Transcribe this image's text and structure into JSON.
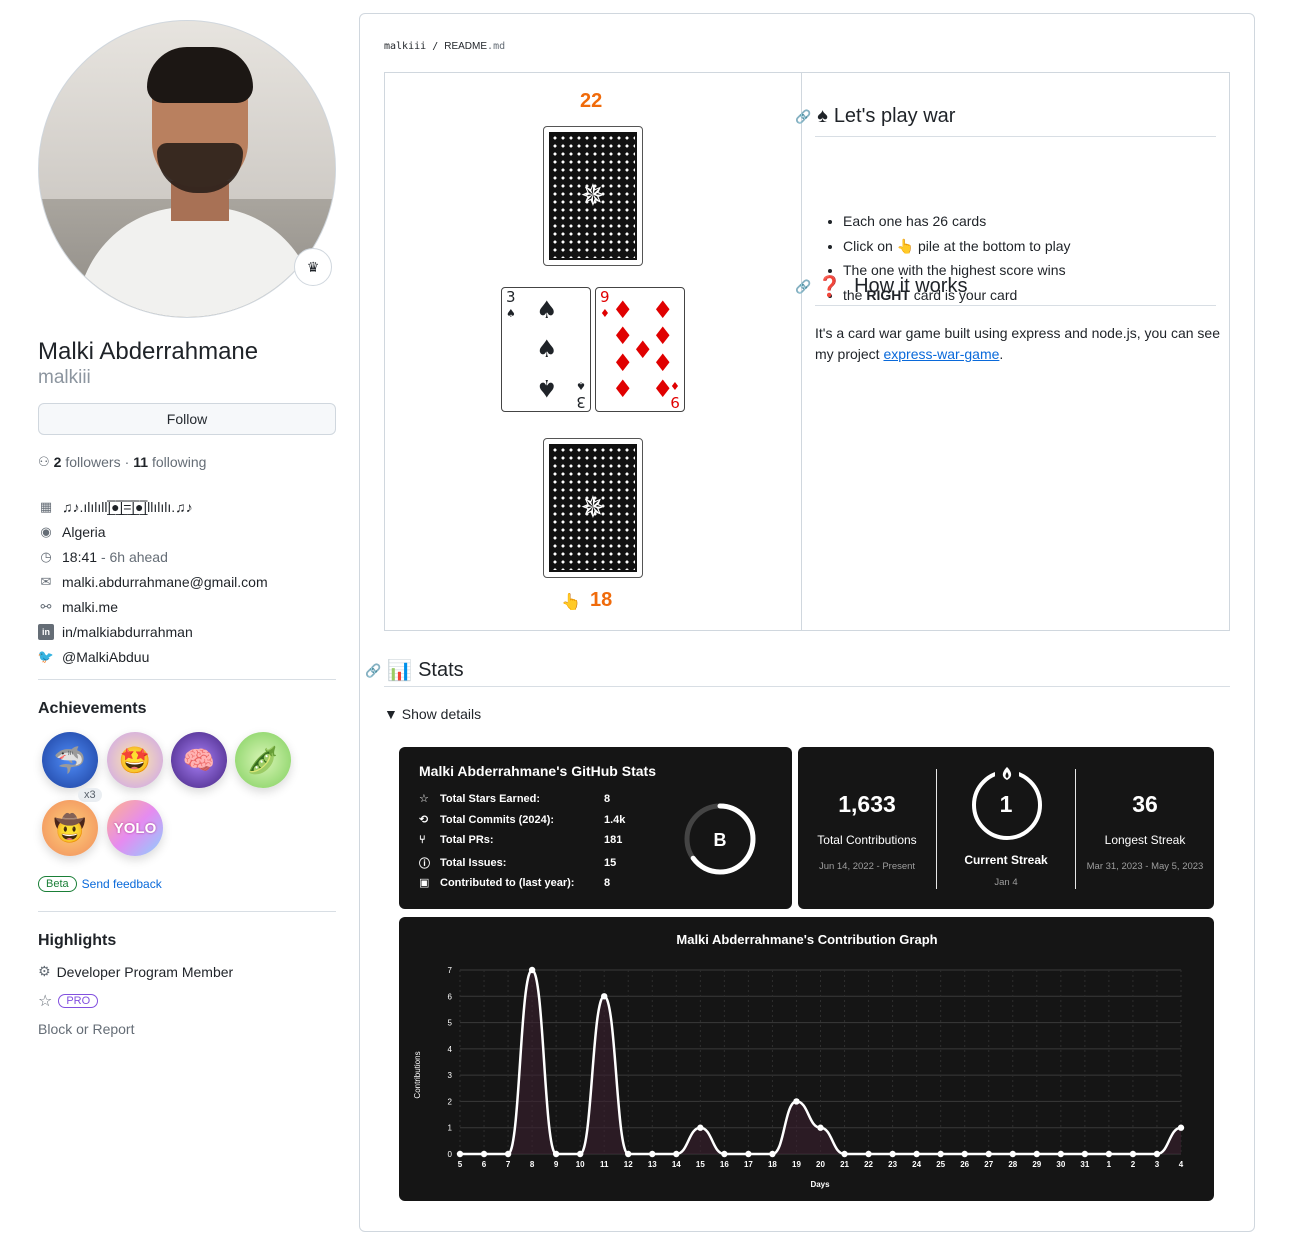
{
  "profile": {
    "name": "Malki Abderrahmane",
    "login": "malkiii",
    "follow_label": "Follow",
    "followers_count": "2",
    "followers_label": "followers",
    "sep": "·",
    "following_count": "11",
    "following_label": "following",
    "company": "♫♪.ılılıll|̲̅̅●̲̅̅|̲̅̅=̲̅̅|̲̅̅●̲̅̅|llılılı.♫♪",
    "location": "Algeria",
    "local_time": "18:41",
    "time_offset": "- 6h ahead",
    "email": "malki.abdurrahmane@gmail.com",
    "website": "malki.me",
    "linkedin": "in/malkiabdurrahman",
    "twitter": "@MalkiAbduu"
  },
  "achievements": {
    "title": "Achievements",
    "items": [
      {
        "name": "shark",
        "glyph": "🦈",
        "count": "x3"
      },
      {
        "name": "starstruck",
        "glyph": "🤩"
      },
      {
        "name": "galaxy-brain",
        "glyph": "🧠"
      },
      {
        "name": "pair-extraordinaire",
        "glyph": "🫛"
      },
      {
        "name": "quickdraw",
        "glyph": "🤠"
      },
      {
        "name": "yolo",
        "glyph": "YOLO"
      }
    ],
    "beta_label": "Beta",
    "feedback_label": "Send feedback"
  },
  "highlights": {
    "title": "Highlights",
    "developer_program": "Developer Program Member",
    "pro_label": "PRO",
    "block_label": "Block or Report"
  },
  "readme": {
    "crumb_user": "malkiii",
    "crumb_sep": "/",
    "crumb_file": "README",
    "crumb_ext": ".md",
    "opponent_score": "22",
    "player_score": "18",
    "pointer_glyph": "👆",
    "left_card": {
      "rank": "3",
      "suit": "♠",
      "color": "#000000"
    },
    "right_card": {
      "rank": "9",
      "suit": "♦",
      "color": "#e00000"
    },
    "war_heading": "Let's play war",
    "war_glyph": "♠",
    "rules": [
      "Each one has 26 cards",
      "Click on 👆 pile at the bottom to play",
      "The one with the highest score wins"
    ],
    "rule4_pre": "the ",
    "rule4_bold": "RIGHT",
    "rule4_post": " card is your card",
    "how_heading": "How it works",
    "how_glyph": "❓",
    "how_text": "It's a card war game built using express and node.js, you can see my project ",
    "how_link": "express-war-game",
    "how_end": ".",
    "stats_heading": "Stats",
    "stats_glyph": "📊",
    "details_label": "▼ Show details"
  },
  "github_stats": {
    "title": "Malki Abderrahmane's GitHub Stats",
    "rows": [
      {
        "icon": "☆",
        "label": "Total Stars Earned:",
        "value": "8"
      },
      {
        "icon": "⟲",
        "label": "Total Commits (2024):",
        "value": "1.4k"
      },
      {
        "icon": "⑂",
        "label": "Total PRs:",
        "value": "181"
      },
      {
        "icon": "ⓘ",
        "label": "Total Issues:",
        "value": "15"
      },
      {
        "icon": "▣",
        "label": "Contributed to (last year):",
        "value": "8"
      }
    ],
    "grade": "B",
    "grade_progress": 0.65
  },
  "streak": {
    "total": "1,633",
    "total_label": "Total Contributions",
    "total_range": "Jun 14, 2022 - Present",
    "current": "1",
    "current_label": "Current Streak",
    "current_range": "Jan 4",
    "longest": "36",
    "longest_label": "Longest Streak",
    "longest_range": "Mar 31, 2023 - May 5, 2023"
  },
  "chart_data": {
    "type": "line",
    "title": "Malki Abderrahmane's Contribution Graph",
    "xlabel": "Days",
    "ylabel": "Contributions",
    "x": [
      "5",
      "6",
      "7",
      "8",
      "9",
      "10",
      "11",
      "12",
      "13",
      "14",
      "15",
      "16",
      "17",
      "18",
      "19",
      "20",
      "21",
      "22",
      "23",
      "24",
      "25",
      "26",
      "27",
      "28",
      "29",
      "30",
      "31",
      "1",
      "2",
      "3",
      "4"
    ],
    "values": [
      0,
      0,
      0,
      7,
      0,
      0,
      6,
      0,
      0,
      0,
      1,
      0,
      0,
      0,
      2,
      1,
      0,
      0,
      0,
      0,
      0,
      0,
      0,
      0,
      0,
      0,
      0,
      0,
      0,
      0,
      1
    ],
    "ylim": [
      0,
      7
    ],
    "yticks": [
      0,
      1,
      2,
      3,
      4,
      5,
      6,
      7
    ],
    "grid": true,
    "colors": {
      "line": "#ffffff",
      "background": "#151515",
      "area": "#3a1f2e"
    }
  }
}
